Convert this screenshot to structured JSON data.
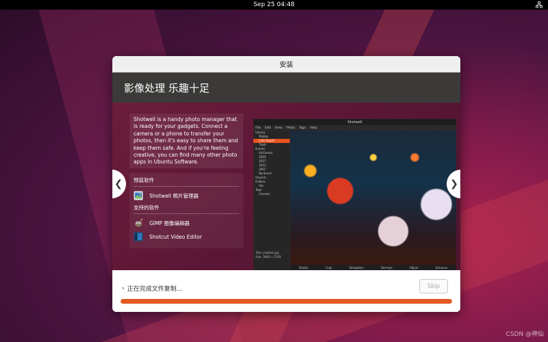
{
  "topbar": {
    "datetime": "Sep 25  04:48"
  },
  "window": {
    "title": "安装"
  },
  "slide": {
    "heading": "影像处理 乐趣十足",
    "description": "Shotwell is a handy photo manager that is ready for your gadgets. Connect a camera or a phone to transfer your photos, then it's easy to share them and keep them safe. And if you're feeling creative, you can find many other photo apps in Ubuntu Software.",
    "included_label": "预装软件",
    "included_apps": [
      {
        "name": "Shotwell 照片管理器",
        "icon": "shotwell-icon"
      }
    ],
    "supported_label": "支持的软件",
    "supported_apps": [
      {
        "name": "GIMP 图像编辑器",
        "icon": "gimp-icon"
      },
      {
        "name": "Shotcut Video Editor",
        "icon": "shotcut-icon"
      }
    ],
    "prev_arrow": "❮",
    "next_arrow": "❯"
  },
  "screenshot": {
    "title": "Shotwell",
    "menu": [
      "File",
      "Edit",
      "View",
      "Photo",
      "Tags",
      "Help"
    ],
    "sidebar": [
      {
        "label": "Library",
        "type": "header"
      },
      {
        "label": "Photos",
        "type": "sub"
      },
      {
        "label": "Last Import",
        "type": "sub-selected"
      },
      {
        "label": "Trash",
        "type": "sub"
      },
      {
        "label": "Events",
        "type": "header"
      },
      {
        "label": "All Events",
        "type": "sub"
      },
      {
        "label": "2020",
        "type": "sub"
      },
      {
        "label": "2017",
        "type": "sub"
      },
      {
        "label": "2011",
        "type": "sub"
      },
      {
        "label": "2007",
        "type": "sub"
      },
      {
        "label": "No Event",
        "type": "sub"
      },
      {
        "label": "Imports",
        "type": "header"
      },
      {
        "label": "Folders",
        "type": "header"
      },
      {
        "label": "tim",
        "type": "sub"
      },
      {
        "label": "Tags",
        "type": "header"
      },
      {
        "label": "Cosmos",
        "type": "sub"
      }
    ],
    "meta": {
      "title_line": "Title:  jellyfish.jpg",
      "size_line": "Size:  3840 × 2160"
    },
    "tools": [
      "Rotate",
      "Crop",
      "Straighten",
      "Red-eye",
      "Adjust",
      "Enhance"
    ]
  },
  "footer": {
    "status": "正在完成文件复制...",
    "status_chevron": "›",
    "skip_label": "Skip",
    "progress_fraction": 1.0
  },
  "watermark": "CSDN @神仙"
}
